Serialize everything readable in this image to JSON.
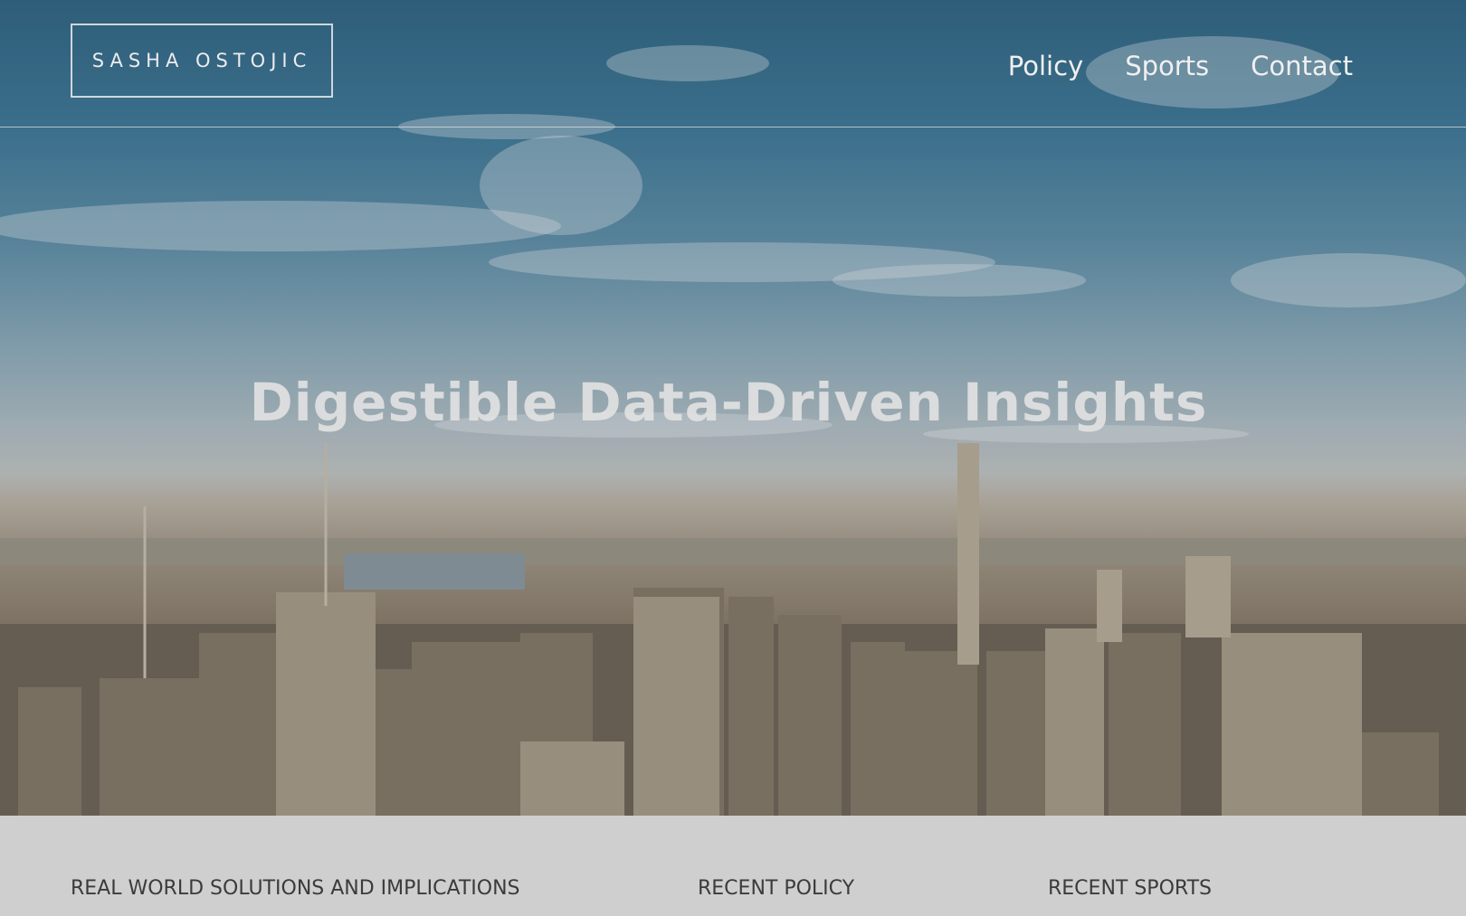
{
  "site": {
    "logo_text": "SASHA OSTOJIC"
  },
  "nav": {
    "items": [
      {
        "label": "Policy"
      },
      {
        "label": "Sports"
      },
      {
        "label": "Contact"
      }
    ]
  },
  "hero": {
    "headline": "Digestible Data-Driven Insights",
    "image_description_icon": "city-skyline-photo"
  },
  "sections": {
    "headings": [
      "REAL WORLD SOLUTIONS AND IMPLICATIONS",
      "RECENT POLICY",
      "RECENT SPORTS"
    ]
  },
  "colors": {
    "sky": "#3e7897",
    "footer_bg": "#cfcfcf",
    "heading_text": "#3b3b3b",
    "nav_text": "#f0f0f0"
  }
}
